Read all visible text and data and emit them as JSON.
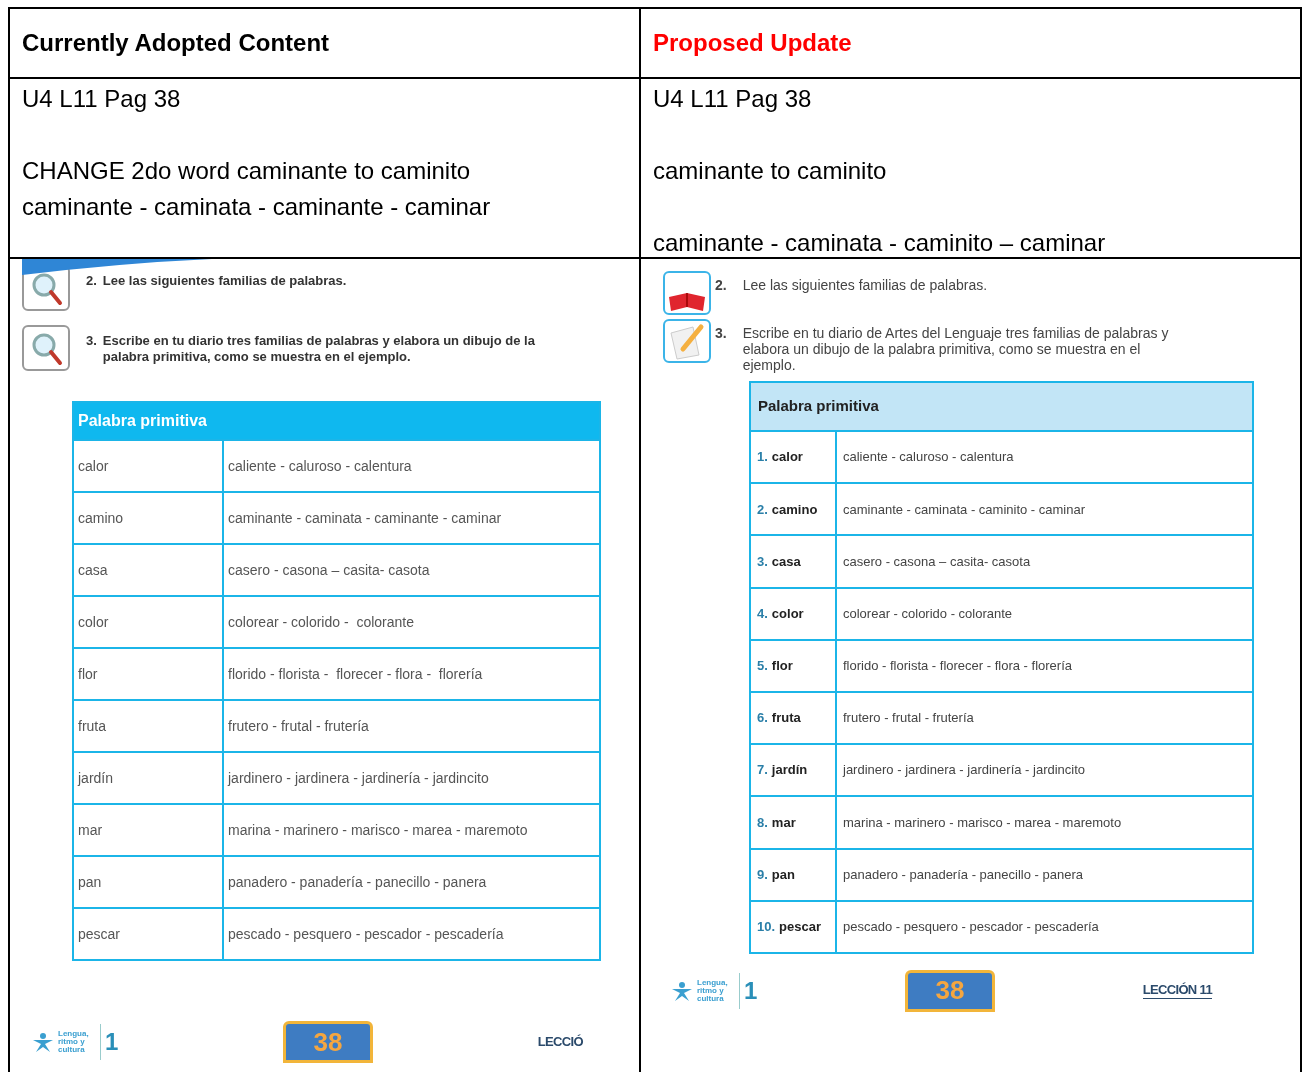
{
  "header": [
    {
      "label": "Currently Adopted Content",
      "color": "#000000"
    },
    {
      "label": "Proposed Update",
      "color": "#ff0000"
    }
  ],
  "notes": [
    {
      "blocks": [
        [
          "U4 L11 Pag 38"
        ],
        [
          "CHANGE 2do word caminante to caminito",
          "caminante - caminata - caminante - caminar"
        ]
      ]
    },
    {
      "blocks": [
        [
          "U4 L11 Pag 38"
        ],
        [
          "caminante to caminito"
        ],
        [
          "caminante - caminata - caminito – caminar"
        ]
      ]
    }
  ],
  "pages": [
    {
      "kind": "scan",
      "tasks": [
        {
          "number": "2.",
          "text": "Lee las siguientes familias de palabras."
        },
        {
          "number": "3.",
          "text": "Escribe en tu diario tres familias de palabras y elabora un dibujo de la palabra primitiva, como se muestra en el ejemplo."
        }
      ],
      "table": {
        "title": "Palabra primitiva",
        "rows": [
          {
            "word": "calor",
            "family": "caliente - caluroso - calentura"
          },
          {
            "word": "camino",
            "family": "caminante - caminata - caminante - caminar"
          },
          {
            "word": "casa",
            "family": "casero - casona – casita- casota"
          },
          {
            "word": "color",
            "family": "colorear - colorido -  colorante"
          },
          {
            "word": "flor",
            "family": "florido - florista -  florecer - flora -  florería"
          },
          {
            "word": "fruta",
            "family": "frutero - frutal - frutería"
          },
          {
            "word": "jardín",
            "family": "jardinero - jardinera - jardinería - jardincito"
          },
          {
            "word": "mar",
            "family": "marina - marinero - marisco - marea - maremoto"
          },
          {
            "word": "pan",
            "family": "panadero - panadería - panecillo - panera"
          },
          {
            "word": "pescar",
            "family": "pescado - pesquero - pescador - pescadería"
          }
        ]
      },
      "footer": {
        "logo_text": "Lengua, ritmo y cultura",
        "grade": "1",
        "page_number": "38",
        "lesson": "LECCIÓ"
      }
    },
    {
      "kind": "revised",
      "tasks": [
        {
          "number": "2.",
          "text": "Lee las siguientes familias de palabras."
        },
        {
          "number": "3.",
          "text": "Escribe en tu diario de Artes del Lenguaje tres familias de palabras y elabora un dibujo de la palabra primitiva, como se muestra en el ejemplo."
        }
      ],
      "table": {
        "title": "Palabra primitiva",
        "rows": [
          {
            "number": "1.",
            "word": "calor",
            "family": "caliente - caluroso - calentura"
          },
          {
            "number": "2.",
            "word": "camino",
            "family": "caminante - caminata - caminito - caminar"
          },
          {
            "number": "3.",
            "word": "casa",
            "family": "casero - casona – casita- casota"
          },
          {
            "number": "4.",
            "word": "color",
            "family": "colorear - colorido - colorante"
          },
          {
            "number": "5.",
            "word": "flor",
            "family": "florido - florista - florecer - flora - florería"
          },
          {
            "number": "6.",
            "word": "fruta",
            "family": "frutero - frutal - frutería"
          },
          {
            "number": "7.",
            "word": "jardín",
            "family": "jardinero - jardinera - jardinería - jardincito"
          },
          {
            "number": "8.",
            "word": "mar",
            "family": "marina - marinero - marisco - marea - maremoto"
          },
          {
            "number": "9.",
            "word": "pan",
            "family": "panadero - panadería - panecillo - panera"
          },
          {
            "number": "10.",
            "word": "pescar",
            "family": "pescado - pesquero - pescador - pescadería"
          }
        ]
      },
      "footer": {
        "logo_text": "Lengua, ritmo y cultura",
        "grade": "1",
        "page_number": "38",
        "lesson": "LECCIÓN 11"
      }
    }
  ]
}
